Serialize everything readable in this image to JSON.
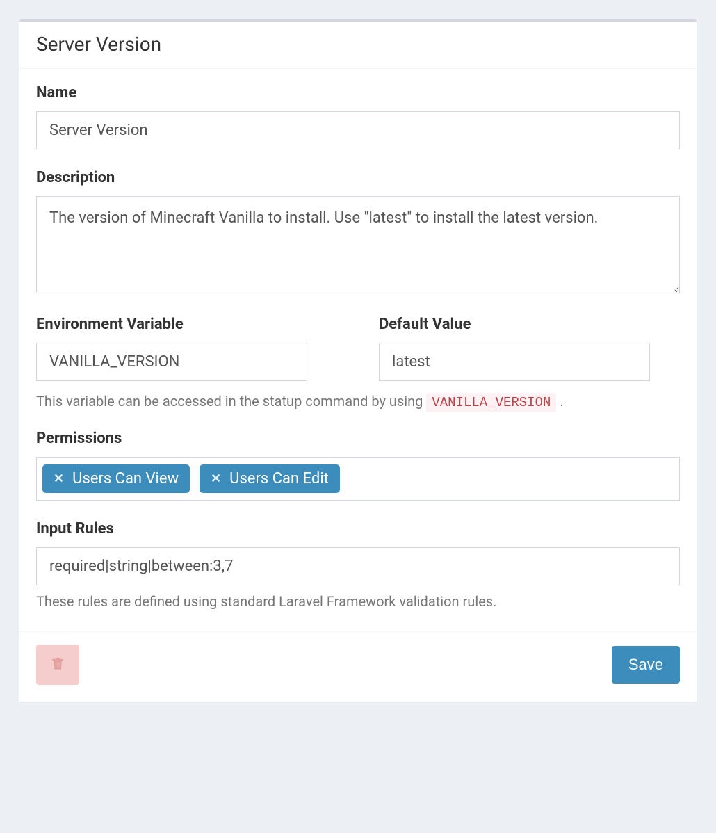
{
  "panel": {
    "title": "Server Version"
  },
  "fields": {
    "name": {
      "label": "Name",
      "value": "Server Version"
    },
    "description": {
      "label": "Description",
      "value": "The version of Minecraft Vanilla to install. Use \"latest\" to install the latest version."
    },
    "env_var": {
      "label": "Environment Variable",
      "value": "VANILLA_VERSION"
    },
    "default_value": {
      "label": "Default Value",
      "value": "latest"
    },
    "env_help_prefix": "This variable can be accessed in the statup command by using ",
    "env_help_code": "VANILLA_VERSION",
    "env_help_suffix": " .",
    "permissions": {
      "label": "Permissions",
      "chips": [
        {
          "label": "Users Can View"
        },
        {
          "label": "Users Can Edit"
        }
      ]
    },
    "input_rules": {
      "label": "Input Rules",
      "value": "required|string|between:3,7",
      "help": "These rules are defined using standard Laravel Framework validation rules."
    }
  },
  "footer": {
    "save_label": "Save"
  }
}
